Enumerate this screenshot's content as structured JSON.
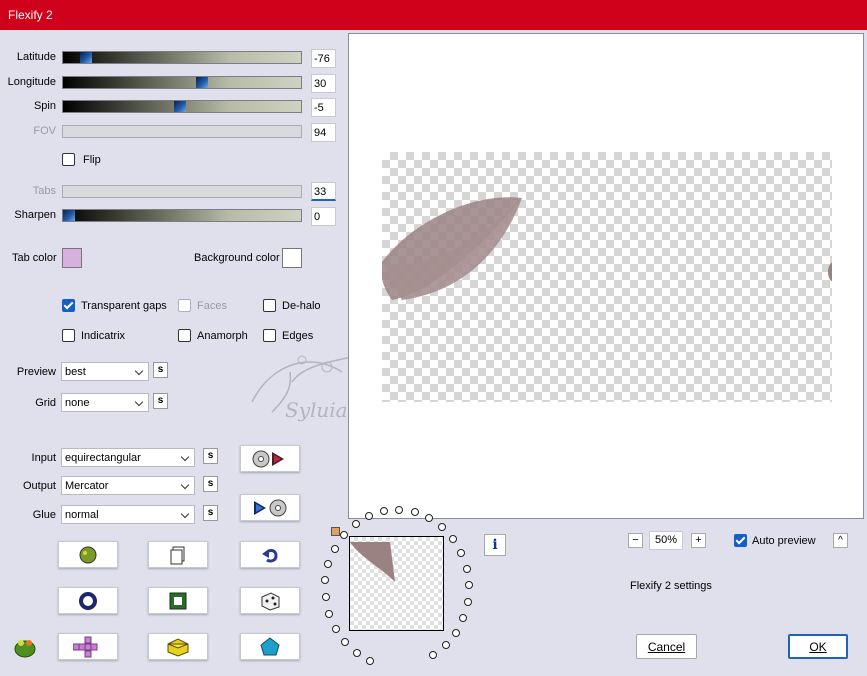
{
  "window": {
    "title": "Flexify 2"
  },
  "sliders": [
    {
      "label": "Latitude",
      "value": "-76",
      "level": 0.08,
      "enabled": true
    },
    {
      "label": "Longitude",
      "value": "30",
      "level": 0.58,
      "enabled": true
    },
    {
      "label": "Spin",
      "value": "-5",
      "level": 0.49,
      "enabled": true
    },
    {
      "label": "FOV",
      "value": "94",
      "level": null,
      "enabled": false
    }
  ],
  "flip": {
    "label": "Flip",
    "checked": false
  },
  "tabs_slider": {
    "label": "Tabs",
    "value": "33",
    "enabled": false
  },
  "sharpen_slider": {
    "label": "Sharpen",
    "value": "0",
    "level": 0.0
  },
  "tab_color": {
    "label": "Tab color",
    "color": "#d8b0e0"
  },
  "background_color": {
    "label": "Background color",
    "color": "#ffffff"
  },
  "options": {
    "transparent_gaps": {
      "label": "Transparent gaps",
      "checked": true
    },
    "faces": {
      "label": "Faces",
      "checked": false,
      "enabled": false
    },
    "de_halo": {
      "label": "De-halo",
      "checked": false
    },
    "indicatrix": {
      "label": "Indicatrix",
      "checked": false
    },
    "anamorph": {
      "label": "Anamorph",
      "checked": false
    },
    "edges": {
      "label": "Edges",
      "checked": false
    }
  },
  "preview_select": {
    "label": "Preview",
    "value": "best"
  },
  "grid_select": {
    "label": "Grid",
    "value": "none"
  },
  "input_select": {
    "label": "Input",
    "value": "equirectangular"
  },
  "output_select": {
    "label": "Output",
    "value": "Mercator"
  },
  "glue_select": {
    "label": "Glue",
    "value": "normal"
  },
  "s_button": "s",
  "watermark": "Syluiane",
  "zoom": {
    "minus": "−",
    "value": "50%",
    "plus": "+"
  },
  "auto_preview": {
    "label": "Auto preview",
    "checked": true
  },
  "auto_preview_caret": "^",
  "settings_caption": "Flexify 2 settings",
  "info_icon_glyph": "i",
  "buttons": {
    "cancel": "Cancel",
    "ok": "OK"
  },
  "colors": {
    "titlebar": "#d0021b",
    "client": "#dfe0eb",
    "shape": "#9a8282",
    "accent": "#1560c8"
  }
}
